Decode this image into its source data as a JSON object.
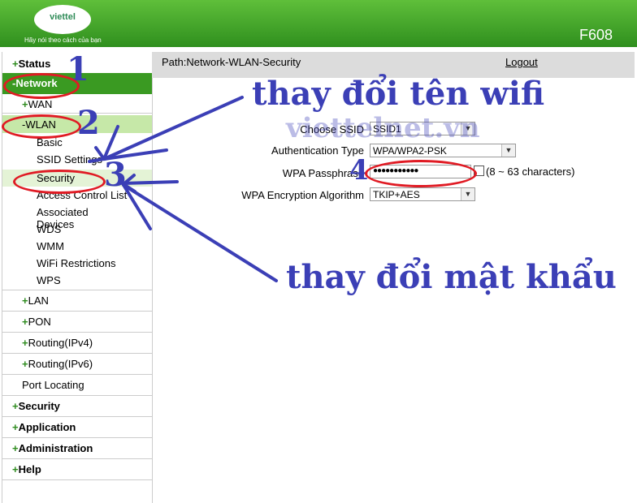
{
  "header": {
    "logo": "viettel",
    "slogan": "Hãy nói theo cách của bạn",
    "model": "F608"
  },
  "topbar": {
    "path": "Path:Network-WLAN-Security",
    "logout": "Logout"
  },
  "sidebar": {
    "status": "Status",
    "network": "-Network",
    "wan": "WAN",
    "wlan": "-WLAN",
    "basic": "Basic",
    "ssid_settings": "SSID Settings",
    "security_sub": "Security",
    "acl": "Access Control List",
    "associated": "Associated Devices",
    "wds": "WDS",
    "wmm": "WMM",
    "wifi_restrictions": "WiFi Restrictions",
    "wps": "WPS",
    "lan": "LAN",
    "pon": "PON",
    "routing4": "Routing(IPv4)",
    "routing6": "Routing(IPv6)",
    "port_locating": "Port Locating",
    "security": "Security",
    "application": "Application",
    "administration": "Administration",
    "help": "Help"
  },
  "form": {
    "ssid_label": "Choose SSID",
    "ssid_value": "SSID1",
    "auth_label": "Authentication Type",
    "auth_value": "WPA/WPA2-PSK",
    "pass_label": "WPA Passphrase",
    "pass_value": "●●●●●●●●●●●",
    "pass_hint": "(8 ~ 63 characters)",
    "enc_label": "WPA Encryption Algorithm",
    "enc_value": "TKIP+AES"
  },
  "annotations": {
    "n1": "1",
    "n2": "2",
    "n3": "3",
    "n4": "4",
    "wifi_name": "thay đổi tên wifi",
    "watermark": "viettelnet.vn",
    "password": "thay đổi mật khẩu"
  },
  "colors": {
    "brand_green": "#3a9a22",
    "annotation_blue": "#3b3fb6",
    "annotation_red": "#e01b24"
  }
}
